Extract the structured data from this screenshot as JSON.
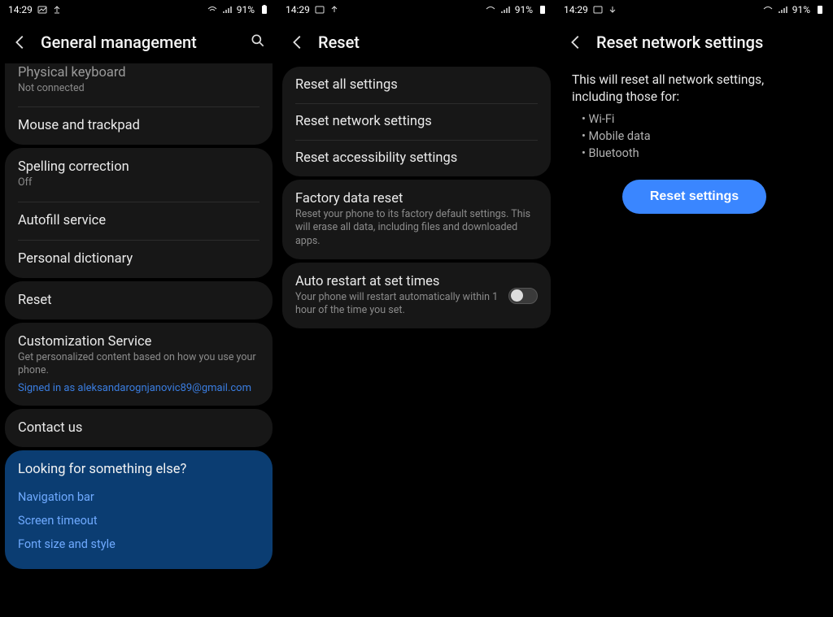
{
  "statusbar": {
    "time": "14:29",
    "battery": "91%"
  },
  "col1": {
    "title": "General management",
    "groupA": [
      {
        "t": "Physical keyboard",
        "s": "Not connected"
      },
      {
        "t": "Mouse and trackpad"
      }
    ],
    "groupB": [
      {
        "t": "Spelling correction",
        "s": "Off"
      },
      {
        "t": "Autofill service"
      },
      {
        "t": "Personal dictionary"
      }
    ],
    "groupC": [
      {
        "t": "Reset"
      }
    ],
    "groupD": [
      {
        "t": "Customization Service",
        "s": "Get personalized content based on how you use your phone.",
        "link": "Signed in as aleksandarognjanovic89@gmail.com"
      }
    ],
    "groupE": [
      {
        "t": "Contact us"
      }
    ],
    "blue": {
      "q": "Looking for something else?",
      "links": [
        "Navigation bar",
        "Screen timeout",
        "Font size and style"
      ]
    }
  },
  "col2": {
    "title": "Reset",
    "groupA": [
      {
        "t": "Reset all settings"
      },
      {
        "t": "Reset network settings"
      },
      {
        "t": "Reset accessibility settings"
      }
    ],
    "groupB": [
      {
        "t": "Factory data reset",
        "s": "Reset your phone to its factory default settings. This will erase all data, including files and downloaded apps."
      }
    ],
    "groupC": [
      {
        "t": "Auto restart at set times",
        "s": "Your phone will restart automatically within 1 hour of the time you set.",
        "toggle": false
      }
    ]
  },
  "col3": {
    "title": "Reset network settings",
    "desc": "This will reset all network settings, including those for:",
    "bullets": [
      "Wi-Fi",
      "Mobile data",
      "Bluetooth"
    ],
    "button": "Reset settings"
  }
}
